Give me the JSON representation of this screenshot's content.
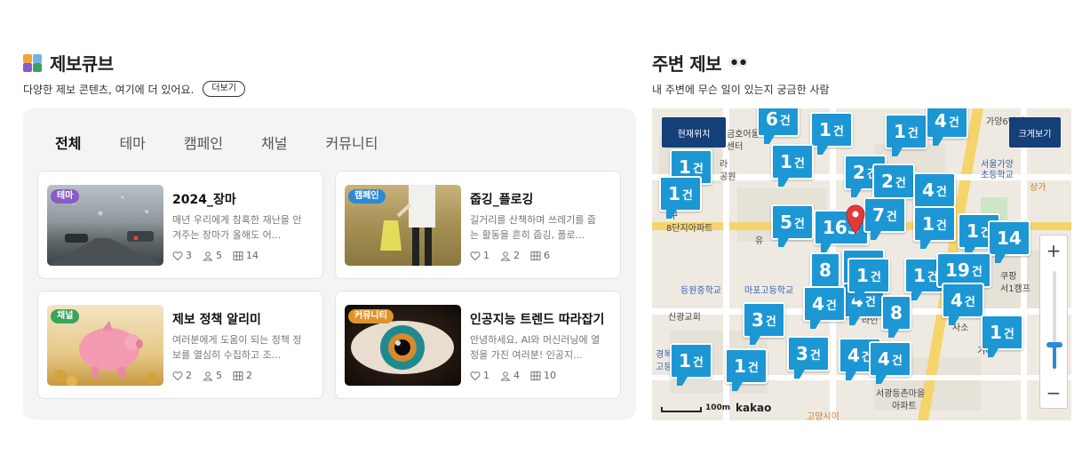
{
  "cube": {
    "title": "제보큐브",
    "subtitle": "다양한 제보 콘텐츠, 여기에 더 있어요.",
    "more_label": "더보기",
    "tabs": [
      "전체",
      "테마",
      "캠페인",
      "채널",
      "커뮤니티"
    ],
    "active_tab": "전체",
    "cards": [
      {
        "badge": "테마",
        "badge_color": "#8a5cc7",
        "title": "2024_장마",
        "desc": "매년 우리에게 참혹한 재난을 안겨주는 장마가 올해도 어...",
        "likes": "3",
        "members": "5",
        "posts": "14"
      },
      {
        "badge": "캠페인",
        "badge_color": "#2a8ad6",
        "title": "줍깅_플로깅",
        "desc": "길거리를 산책하며 쓰레기를 줍는 활동을 흔히 줍깅, 플로...",
        "likes": "1",
        "members": "2",
        "posts": "6"
      },
      {
        "badge": "채널",
        "badge_color": "#3aa35c",
        "title": "제보 정책 알리미",
        "desc": "여러분에게 도움이 되는 정책 정보를 열심히 수집하고 조...",
        "likes": "2",
        "members": "5",
        "posts": "2"
      },
      {
        "badge": "커뮤니티",
        "badge_color": "#e0932a",
        "title": "인공지능 트렌드 따라잡기",
        "desc": "안녕하세요, AI와 머신러닝에 열정을 가진 여러분! 인공지...",
        "likes": "1",
        "members": "4",
        "posts": "10"
      }
    ]
  },
  "nearby": {
    "title": "주변 제보",
    "subtitle": "내 주변에 무슨 일이 있는지 궁금한 사람",
    "current_location_label": "현재위치",
    "enlarge_label": "크게보기",
    "zoom_in": "+",
    "zoom_out": "−",
    "zoom_level": 0.25,
    "scale_label": "100m",
    "map_logo": "kakao",
    "unit": "건",
    "map_labels": [
      "가양6단지",
      "금호어울",
      "센터",
      "라",
      "공원",
      "롯데",
      "서울가양",
      "초등학교",
      "상가",
      "구",
      "8단지아파트",
      "유",
      "쿠팡",
      "서1캠프",
      "등원중학교",
      "마포고등학교",
      "신광교회",
      "라인",
      "사소",
      "기아",
      "경복여자",
      "고등학교",
      "서광등촌마을",
      "아파트",
      "고양시이"
    ],
    "markers": [
      "6",
      "1",
      "1",
      "1",
      "1",
      "1",
      "2",
      "2",
      "4",
      "5",
      "163",
      "7",
      "1",
      "1",
      "14",
      "12",
      "8",
      "1",
      "19",
      "4",
      "4",
      "4",
      "8",
      "1",
      "3",
      "4",
      "4",
      "1",
      "1",
      "3",
      "1",
      "4"
    ]
  }
}
